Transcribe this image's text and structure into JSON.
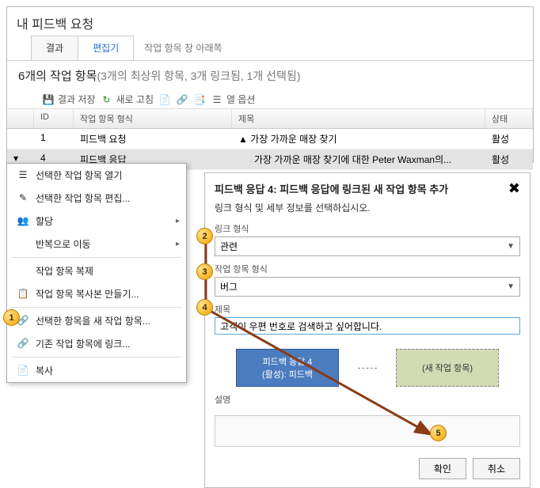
{
  "panel": {
    "title": "내 피드백 요청",
    "tabs": {
      "results": "결과",
      "editor": "편집기"
    },
    "meta": "작업 항목 창 아래쪽"
  },
  "summary": {
    "main": "6개의 작업 항목",
    "sub": "(3개의 최상위 항목, 3개 링크됨, 1개 선택됨)"
  },
  "toolbar": {
    "save": "결과 저장",
    "refresh": "새로 고침",
    "columns": "열 옵션"
  },
  "grid": {
    "headers": {
      "id": "ID",
      "type": "작업 항목 형식",
      "title": "제목",
      "state": "상태"
    },
    "rows": [
      {
        "expander": "",
        "id": "1",
        "type": "피드백 요청",
        "title_prefix": "▲",
        "title": "가장 가까운 매장 찾기",
        "state": "활성"
      },
      {
        "expander": "▾",
        "id": "4",
        "type": "피드백 응답",
        "title_prefix": "",
        "title": "가장 가까운 매장 찾기에 대한 Peter Waxman의...",
        "state": "활성"
      }
    ]
  },
  "ctx": {
    "open": "선택한 작업 항목 열기",
    "edit": "선택한 작업 항목 편집...",
    "assign": "할당",
    "iteration": "반복으로 이동",
    "clone": "작업 항목 복제",
    "copy": "작업 항목 복사본 만들기...",
    "new": "선택한 항목을 새 작업 항목...",
    "link": "기존 작업 항목에 링크...",
    "copy2": "복사"
  },
  "dialog": {
    "title": "피드백 응답 4: 피드백 응답에 링크된 새 작업 항목 추가",
    "sub": "링크 형식 및 세부 정보를 선택하십시오.",
    "link_type_label": "링크 형식",
    "link_type_value": "관련",
    "item_type_label": "작업 항목 형식",
    "item_type_value": "버그",
    "title_label": "제목",
    "title_value": "고객이 우편 번호로 검색하고 싶어합니다.",
    "box_a_line1": "피드백 응답 4",
    "box_a_line2": "(활성): 피드백",
    "box_b": "(새 작업 항목)",
    "desc_label": "설명",
    "ok": "확인",
    "cancel": "취소"
  }
}
